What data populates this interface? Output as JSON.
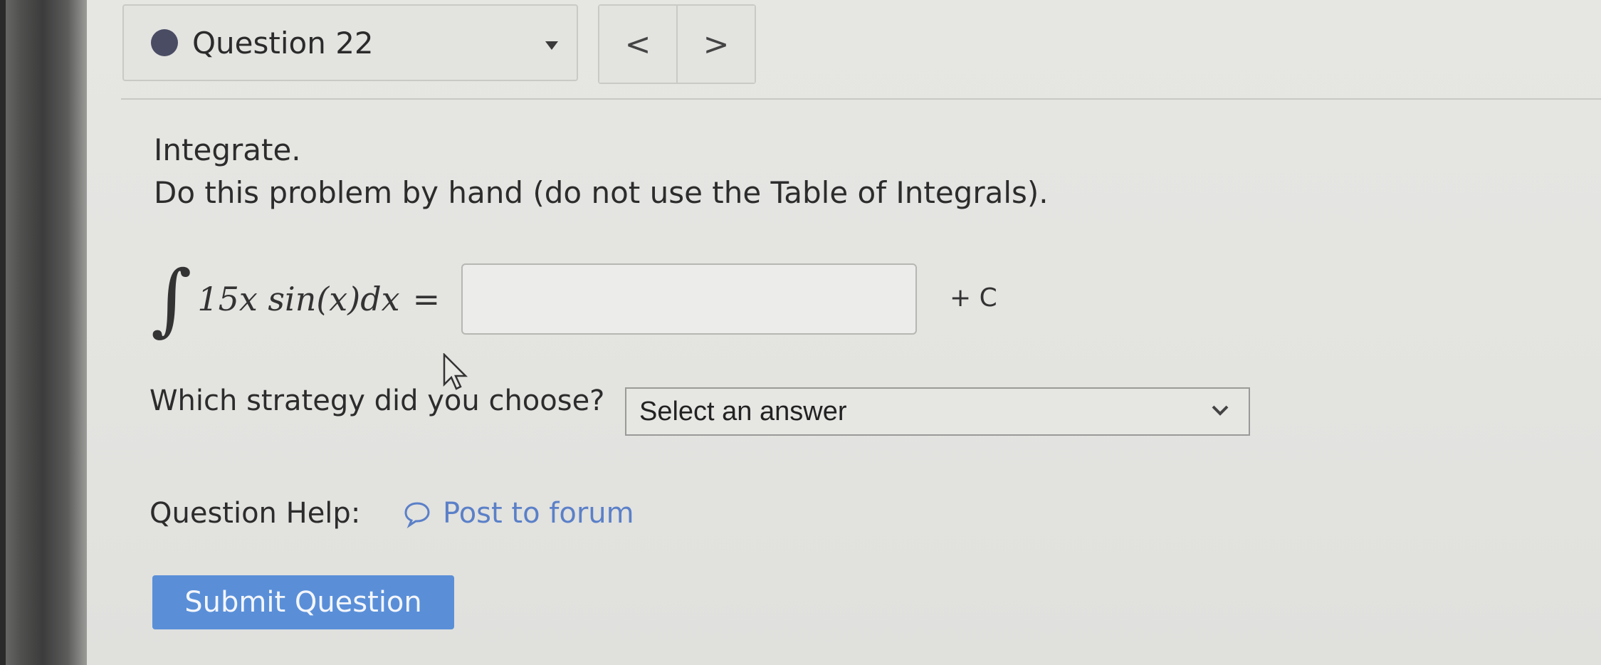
{
  "question_nav": {
    "label": "Question 22",
    "prev_symbol": "<",
    "next_symbol": ">"
  },
  "prompt": {
    "line1": "Integrate.",
    "line2": "Do this problem by hand (do not use the Table of Integrals)."
  },
  "math": {
    "integral_symbol": "∫",
    "expression": "15x sin(x)dx",
    "equals": "=",
    "answer_value": "",
    "constant": "+ C"
  },
  "strategy": {
    "label": "Which strategy did you choose?",
    "selected": "Select an answer"
  },
  "help": {
    "label": "Question Help:",
    "forum_link": "Post to forum"
  },
  "submit_label": "Submit Question",
  "colors": {
    "accent": "#5a8fd8",
    "link": "#5b80c8",
    "status_dot": "#4a4c64"
  }
}
